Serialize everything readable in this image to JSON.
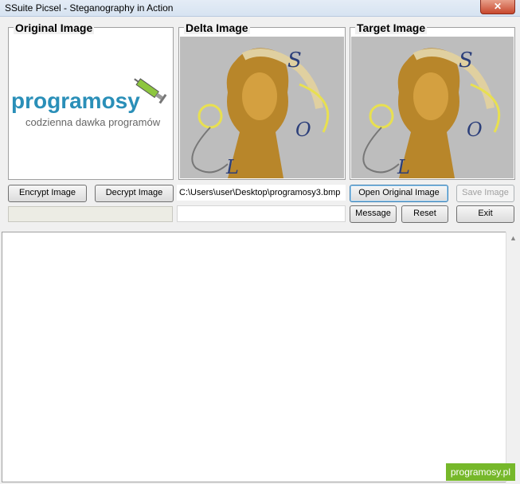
{
  "window": {
    "title": "SSuite Picsel - Steganography in Action",
    "close_label": "✕"
  },
  "groups": {
    "original": "Original Image",
    "delta": "Delta Image",
    "target": "Target Image"
  },
  "original_image": {
    "logo_text": "programosy",
    "logo_sub": "codzienna dawka programów"
  },
  "letters": {
    "s": "S",
    "o": "O",
    "l": "L"
  },
  "buttons": {
    "encrypt": "Encrypt Image",
    "decrypt": "Decrypt Image",
    "open_original": "Open Original Image",
    "save": "Save Image",
    "message": "Message",
    "reset": "Reset",
    "exit": "Exit"
  },
  "file_path": "C:\\Users\\user\\Desktop\\programosy3.bmp",
  "message_text": "",
  "watermark": "programosy.pl",
  "colors": {
    "logo_blue": "#2a8fb8",
    "watermark_green": "#76b82a",
    "face_gold": "#b8862a"
  }
}
